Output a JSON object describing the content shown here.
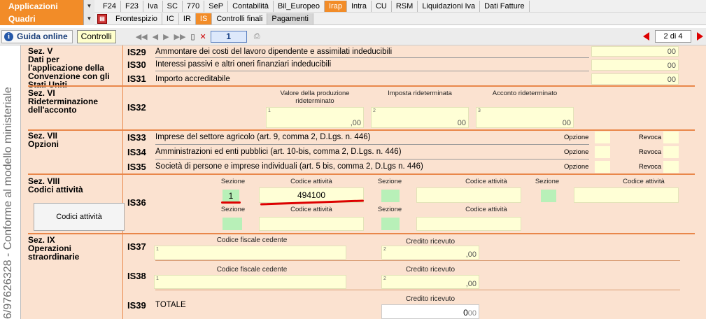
{
  "top": {
    "applicazioni_label": "Applicazioni",
    "quadri_label": "Quadri",
    "tabs_row1": [
      "F24",
      "F23",
      "Iva",
      "SC",
      "770",
      "SeP",
      "Contabilità",
      "Bil_Europeo",
      "Irap",
      "Intra",
      "CU",
      "RSM",
      "Liquidazioni Iva",
      "Dati Fatture"
    ],
    "active_tab_row1": "Irap",
    "tabs_row2": [
      "Frontespizio",
      "IC",
      "IR",
      "IS",
      "Controlli finali",
      "Pagamenti"
    ],
    "active_tab_row2": "IS"
  },
  "toolbar": {
    "guida_label": "Guida online",
    "controlli_label": "Controlli",
    "page_field": "1",
    "page_count": "2 di 4"
  },
  "side": {
    "vertical_text": "6/97626328 - Conforme al modello ministeriale"
  },
  "sections": {
    "sez5": {
      "title": "Sez. V",
      "subtitle": "Dati per l'applicazione della Convenzione con gli Stati Uniti"
    },
    "sez6": {
      "title": "Sez. VI",
      "subtitle": "Rideterminazione dell'acconto"
    },
    "sez7": {
      "title": "Sez. VII",
      "subtitle": "Opzioni"
    },
    "sez8": {
      "title": "Sez. VIII",
      "subtitle": "Codici attività"
    },
    "sez9": {
      "title": "Sez. IX",
      "subtitle": "Operazioni straordinarie"
    }
  },
  "rows": {
    "is29": {
      "code": "IS29",
      "desc": "Ammontare dei costi del lavoro dipendente e assimilati indeducibili",
      "value": "00"
    },
    "is30": {
      "code": "IS30",
      "desc": "Interessi passivi e altri oneri finanziari indeducibili",
      "value": "00"
    },
    "is31": {
      "code": "IS31",
      "desc": "Importo accreditabile",
      "value": "00"
    },
    "is32": {
      "code": "IS32",
      "col1": "Valore della produzione rideterminato",
      "col1_val": ",00",
      "col2": "Imposta rideterminata",
      "col2_val": "00",
      "col3": "Acconto rideterminato",
      "col3_val": "00"
    },
    "is33": {
      "code": "IS33",
      "desc": "Imprese del settore agricolo (art. 9, comma 2, D.Lgs. n. 446)"
    },
    "is34": {
      "code": "IS34",
      "desc": "Amministrazioni ed enti pubblici (art. 10-bis, comma 2, D.Lgs. n. 446)"
    },
    "is35": {
      "code": "IS35",
      "desc": "Società di persone e imprese individuali (art. 5 bis, comma 2, D.Lgs n. 446)"
    },
    "opzione_label": "Opzione",
    "revoca_label": "Revoca",
    "is36": {
      "code": "IS36",
      "sezione_label": "Sezione",
      "codice_label": "Codice attività",
      "sezione_val": "1",
      "codice_val": "494100",
      "button": "Codici attività"
    },
    "is37": {
      "code": "IS37",
      "cf_label": "Codice fiscale cedente",
      "credito_label": "Credito ricevuto",
      "credito_val": ",00"
    },
    "is38": {
      "code": "IS38",
      "cf_label": "Codice fiscale cedente",
      "credito_label": "Credito ricevuto",
      "credito_val": ",00"
    },
    "is39": {
      "code": "IS39",
      "desc": "TOTALE",
      "credito_label": "Credito ricevuto",
      "credito_val": "0",
      "credito_dec": "00"
    }
  }
}
